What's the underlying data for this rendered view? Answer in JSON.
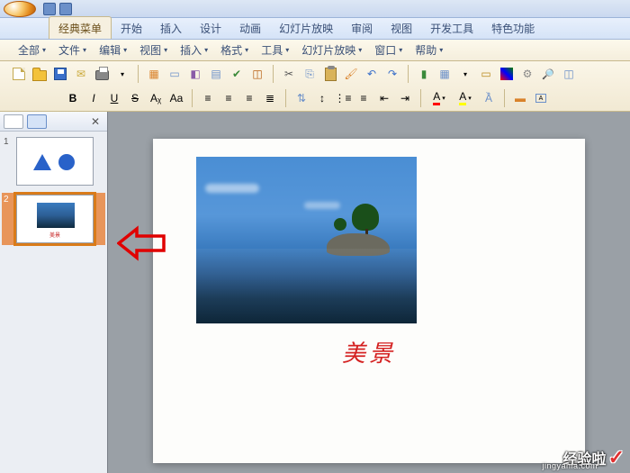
{
  "tabs": {
    "classic": "经典菜单",
    "start": "开始",
    "insert": "插入",
    "design": "设计",
    "anim": "动画",
    "slideshow": "幻灯片放映",
    "review": "审阅",
    "view": "视图",
    "dev": "开发工具",
    "special": "特色功能"
  },
  "menus": {
    "all": "全部",
    "file": "文件",
    "edit": "编辑",
    "view": "视图",
    "insert": "插入",
    "format": "格式",
    "tools": "工具",
    "slideshow": "幻灯片放映",
    "window": "窗口",
    "help": "帮助"
  },
  "format_row": {
    "bold": "B",
    "italic": "I",
    "underline": "U",
    "strike": "S",
    "ax": "Aᵪ",
    "aa": "Aa",
    "fonta": "A",
    "fontb": "A"
  },
  "panel": {
    "close": "✕",
    "slide1_num": "1",
    "slide2_num": "2"
  },
  "slide": {
    "caption": "美景",
    "thumb2_caption": "美景"
  },
  "watermark": {
    "main": "经验啦",
    "sub": "jingyanla.com",
    "check": "✓"
  },
  "icons": {
    "dropdown": "▾",
    "cut": "✂",
    "undo": "↶",
    "redo": "↷",
    "search": "🔎"
  }
}
